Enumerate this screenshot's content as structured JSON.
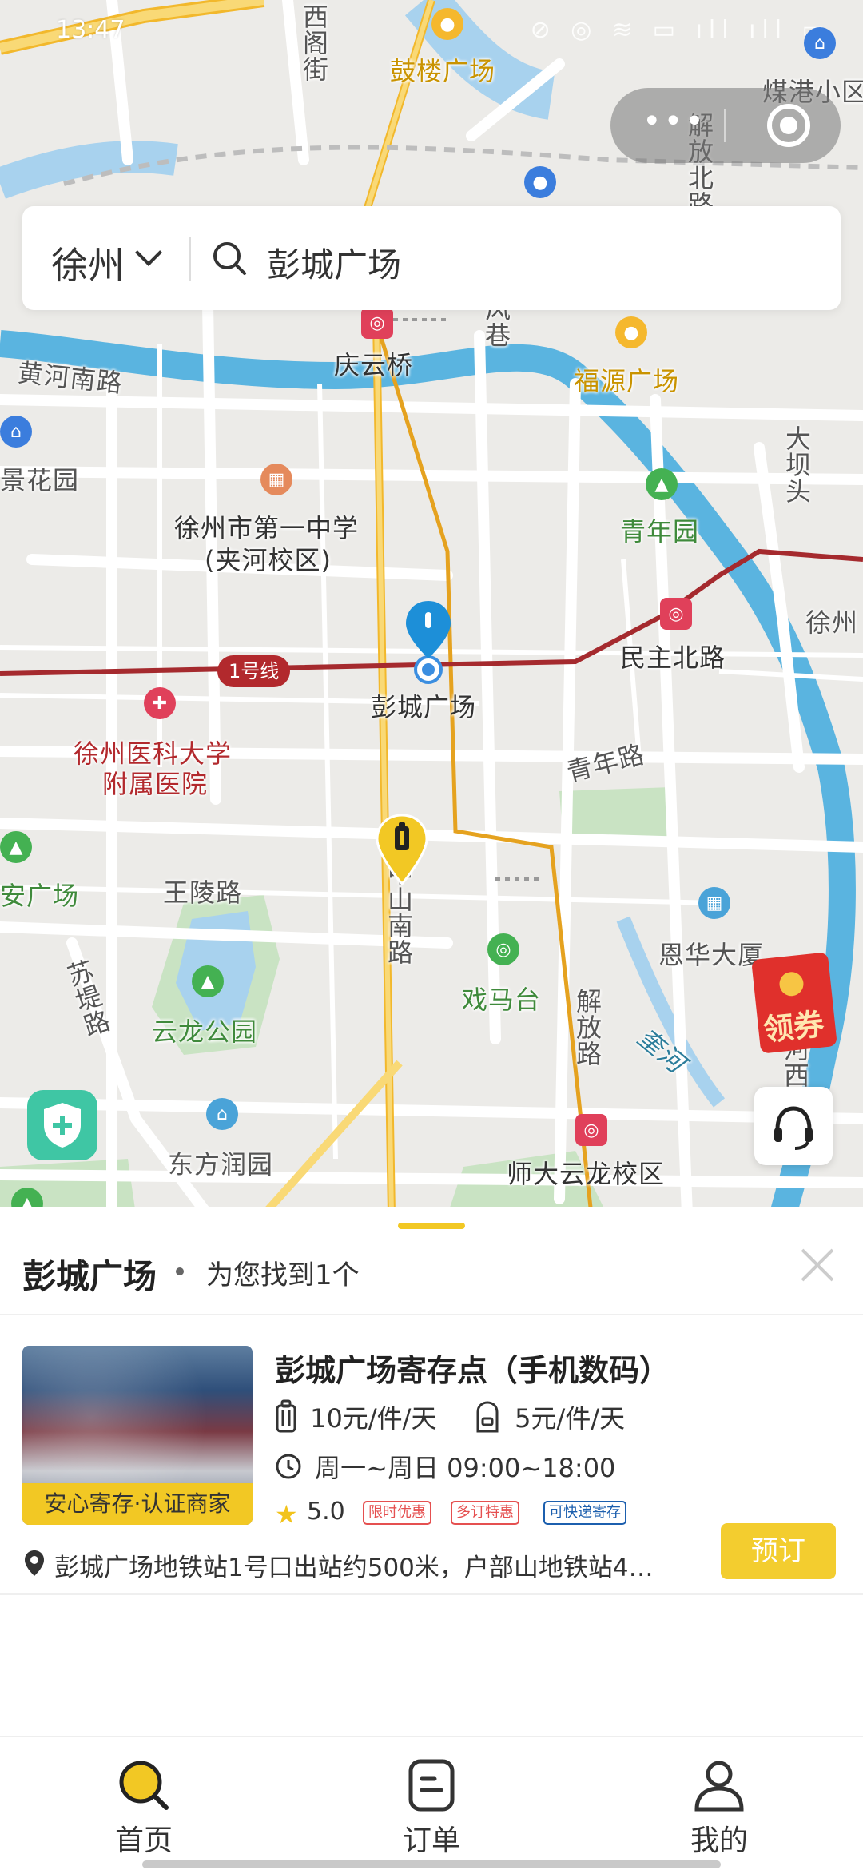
{
  "status_bar": {
    "time": "13:47",
    "icons": "⊘ ◎ ≋ ▭ ıll ıll ▭"
  },
  "search": {
    "city": "徐州",
    "query": "彭城广场"
  },
  "map": {
    "labels": {
      "gulou": "鼓楼广场",
      "xige": "西阁街",
      "meigang": "煤港小区",
      "jiefang_n": "解放北路",
      "qingyunqiao": "庆云桥",
      "fengxiang": "风巷",
      "fuyuan": "福源广场",
      "huanghe": "黄河南路",
      "jinghua": "景花园",
      "dabatou": "大坝头",
      "yizhong": "徐州市第一中学",
      "yizhong_sub": "(夹河校区)",
      "qingnianyuan": "青年园",
      "xuzhou_edge": "徐州",
      "minzhu": "民主北路",
      "pengcheng": "彭城广场",
      "line1": "1号线",
      "yike1": "徐州医科大学",
      "yike2": "附属医院",
      "qingnianlu": "青年路",
      "anguangchang": "安广场",
      "wangling": "王陵路",
      "zhongshan": "中山南路",
      "enhua": "恩华大厦",
      "suti": "苏堤路",
      "yunlong": "云龙公园",
      "ximatai": "戏马台",
      "jiefang_s": "解放路",
      "kuihe": "奎河",
      "hexi": "河西",
      "dongfang": "东方润园",
      "shida": "师大云龙校区"
    }
  },
  "coupon": {
    "label": "领券"
  },
  "sheet": {
    "place": "彭城广场",
    "found": "为您找到1个",
    "store": {
      "badge": "安心寄存·认证商家",
      "title": "彭城广场寄存点（手机数码）",
      "price_large": "10元/件/天",
      "price_small": "5元/件/天",
      "hours": "周一~周日 09:00~18:00",
      "rating": "5.0",
      "tags": [
        "限时优惠",
        "多订特惠",
        "可快递寄存"
      ],
      "address": "彭城广场地铁站1号口出站约500米，户部山地铁站4…",
      "book_label": "预订"
    }
  },
  "tabs": [
    {
      "label": "首页",
      "icon": "search-icon",
      "active": true
    },
    {
      "label": "订单",
      "icon": "order-icon"
    },
    {
      "label": "我的",
      "icon": "person-icon"
    }
  ],
  "colors": {
    "accent": "#f2c824",
    "metro_line": "#a52a2e",
    "river": "#5ab4e0",
    "main_road": "#f2b82c"
  }
}
